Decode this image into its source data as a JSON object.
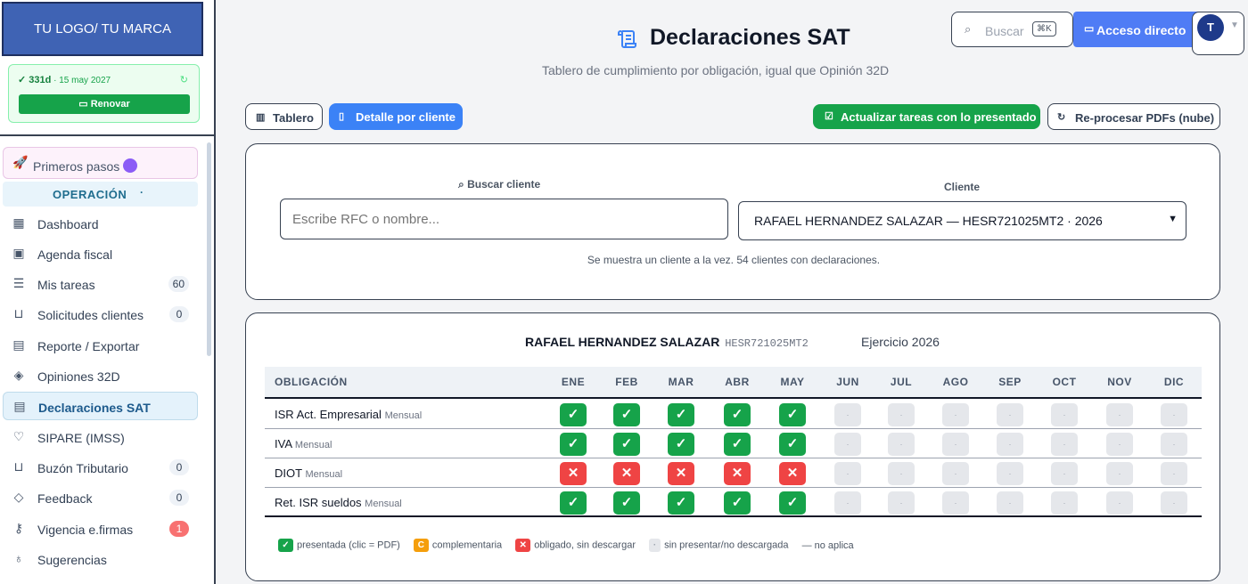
{
  "sidebar": {
    "logo": "TU LOGO/ TU MARCA",
    "subscription": {
      "days": "✓ 331d",
      "sep": " · ",
      "date": "15 may 2027",
      "renew_label": "Renovar"
    },
    "first_steps": "Primeros pasos",
    "section": "OPERACIÓN",
    "section_collapse": "·",
    "items": [
      {
        "label": "Dashboard",
        "icon": "grid-icon",
        "badge": ""
      },
      {
        "label": "Agenda fiscal",
        "icon": "calendar-icon",
        "badge": ""
      },
      {
        "label": "Mis tareas",
        "icon": "checklist-icon",
        "badge": "60"
      },
      {
        "label": "Solicitudes clientes",
        "icon": "inbox-icon",
        "badge": "0"
      },
      {
        "label": "Reporte / Exportar",
        "icon": "file-icon",
        "badge": ""
      },
      {
        "label": "Opiniones 32D",
        "icon": "shield-icon",
        "badge": ""
      },
      {
        "label": "Declaraciones SAT",
        "icon": "scroll-icon",
        "badge": "",
        "active": true
      },
      {
        "label": "SIPARE (IMSS)",
        "icon": "heart-pulse-icon",
        "badge": ""
      },
      {
        "label": "Buzón Tributario",
        "icon": "inbox-icon",
        "badge": "0"
      },
      {
        "label": "Feedback",
        "icon": "layers-icon",
        "badge": "0"
      },
      {
        "label": "Vigencia e.firmas",
        "icon": "key-icon",
        "badge": "1",
        "badge_color": "#f87171"
      },
      {
        "label": "Sugerencias",
        "icon": "lightbulb-icon",
        "badge": ""
      }
    ]
  },
  "header": {
    "title": "Declaraciones SAT",
    "subtitle": "Tablero de cumplimiento por obligación, igual que Opinión 32D",
    "search_label": "Buscar",
    "search_shortcut": "⌘K",
    "direct_access": "Acceso directo",
    "avatar_initial": "T"
  },
  "toolbar": {
    "tablero": "Tablero",
    "detalle": "Detalle por cliente",
    "actualizar": "Actualizar tareas con lo presentado",
    "reprocesar": "Re-procesar PDFs (nube)"
  },
  "filter": {
    "search_label": "Buscar cliente",
    "search_placeholder": "Escribe RFC o nombre...",
    "client_label": "Cliente",
    "client_selected": "RAFAEL HERNANDEZ SALAZAR — HESR721025MT2 · 2026",
    "note": "Se muestra un cliente a la vez. 54 clientes con declaraciones."
  },
  "grid": {
    "client_name": "RAFAEL HERNANDEZ SALAZAR",
    "rfc": "HESR721025MT2",
    "year": "Ejercicio 2026",
    "col_obligation": "OBLIGACIÓN",
    "months": [
      "ENE",
      "FEB",
      "MAR",
      "ABR",
      "MAY",
      "JUN",
      "JUL",
      "AGO",
      "SEP",
      "OCT",
      "NOV",
      "DIC"
    ],
    "rows": [
      {
        "name": "ISR Act. Empresarial",
        "freq": "Mensual",
        "status": [
          "ok",
          "ok",
          "ok",
          "ok",
          "ok",
          "pend",
          "pend",
          "pend",
          "pend",
          "pend",
          "pend",
          "pend"
        ]
      },
      {
        "name": "IVA",
        "freq": "Mensual",
        "status": [
          "ok",
          "ok",
          "ok",
          "ok",
          "ok",
          "pend",
          "pend",
          "pend",
          "pend",
          "pend",
          "pend",
          "pend"
        ]
      },
      {
        "name": "DIOT",
        "freq": "Mensual",
        "status": [
          "no",
          "no",
          "no",
          "no",
          "no",
          "pend",
          "pend",
          "pend",
          "pend",
          "pend",
          "pend",
          "pend"
        ]
      },
      {
        "name": "Ret. ISR sueldos",
        "freq": "Mensual",
        "status": [
          "ok",
          "ok",
          "ok",
          "ok",
          "ok",
          "pend",
          "pend",
          "pend",
          "pend",
          "pend",
          "pend",
          "pend"
        ]
      }
    ],
    "symbols": {
      "ok": "✓",
      "no": "✕",
      "pend": "·"
    },
    "legend": {
      "presentada": "presentada (clic = PDF)",
      "complementaria": "complementaria",
      "complementaria_mark": "C",
      "obligado": "obligado, sin descargar",
      "sin_presentar": "sin presentar/no descargada",
      "no_aplica": "— no aplica"
    }
  },
  "colors": {
    "ok": "#16a34a",
    "no": "#ef4444",
    "pend": "#e5e7eb",
    "complementaria": "#f59e0b",
    "accent": "#3b82f6"
  }
}
